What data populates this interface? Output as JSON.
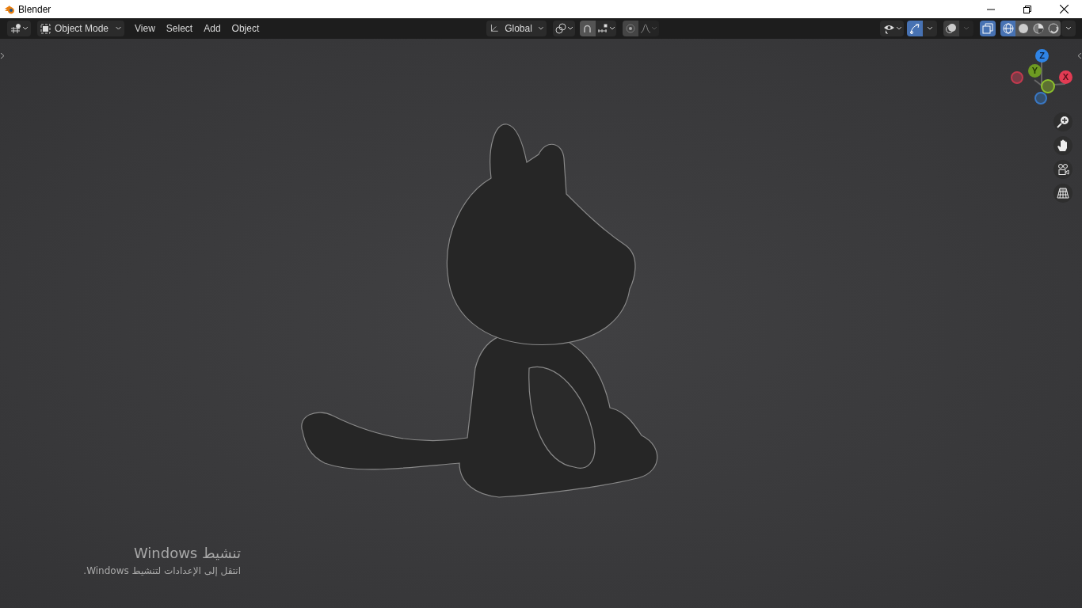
{
  "window": {
    "title": "Blender"
  },
  "header": {
    "mode": "Object Mode",
    "menus": [
      "View",
      "Select",
      "Add",
      "Object"
    ],
    "orientation": "Global",
    "toggles": [
      {
        "on": true
      },
      {
        "on": true
      }
    ],
    "shading": [
      {
        "kind": "wireframe",
        "selected": true
      },
      {
        "kind": "solid",
        "selected": false
      },
      {
        "kind": "material",
        "selected": false
      },
      {
        "kind": "rendered",
        "selected": false
      }
    ]
  },
  "gizmo": {
    "axes": [
      "X",
      "Y",
      "Z"
    ]
  },
  "activation": {
    "title": "تنشيط Windows",
    "message": "انتقل إلى الإعدادات لتنشيط Windows."
  }
}
